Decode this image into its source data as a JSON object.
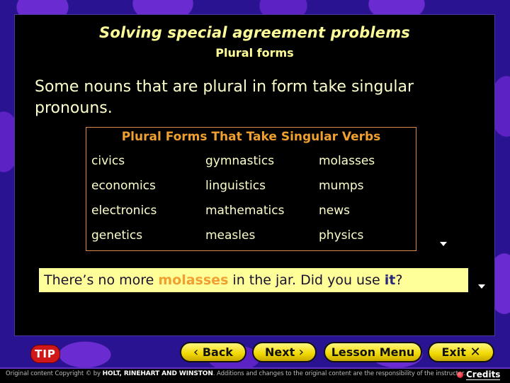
{
  "slide": {
    "title": "Solving special agreement problems",
    "subtitle": "Plural forms",
    "intro": "Some nouns that are plural in form take singular pronouns."
  },
  "table": {
    "title": "Plural Forms That Take Singular Verbs",
    "rows": [
      [
        "civics",
        "gymnastics",
        "molasses"
      ],
      [
        "economics",
        "linguistics",
        "mumps"
      ],
      [
        "electronics",
        "mathematics",
        "news"
      ],
      [
        "genetics",
        "measles",
        "physics"
      ]
    ]
  },
  "example": {
    "part1": "There’s no more ",
    "highlight1": "molasses",
    "part2": " in the jar. Did you use ",
    "highlight2": "it",
    "part3": "?"
  },
  "icons": {
    "advance_arrow": "down-triangle"
  },
  "nav": {
    "tip_label": "TIP",
    "back_label": "Back",
    "back_glyph": "‹",
    "next_label": "Next",
    "next_glyph": "›",
    "lesson_menu_label": "Lesson Menu",
    "exit_label": "Exit",
    "exit_glyph": "✕"
  },
  "footer": {
    "copyright_prefix": "Original content Copyright © by ",
    "publisher": "HOLT, RINEHART AND WINSTON",
    "copyright_suffix": ". Additions and changes to the original content are the responsibility of the instructor.",
    "credits_label": "Credits"
  },
  "colors": {
    "title": "#ffff99",
    "table_title": "#f0a030",
    "table_border": "#e08a4a",
    "example_bg": "#ffff99",
    "button_yellow": "#f0d800",
    "tip_red": "#d01818",
    "background_purple": "#2a1390"
  }
}
